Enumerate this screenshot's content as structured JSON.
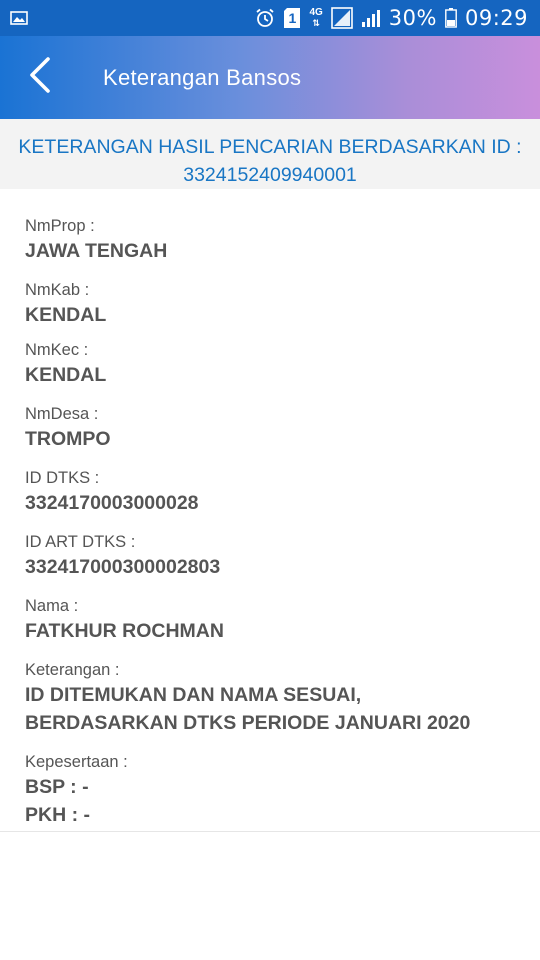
{
  "status_bar": {
    "network": "4G",
    "battery": "30%",
    "time": "09:29",
    "sim_badge": "1",
    "icons": [
      "gallery-icon",
      "alarm-icon",
      "sim-icon",
      "signal-icon",
      "battery-icon"
    ]
  },
  "app_bar": {
    "title": "Keterangan Bansos",
    "back_icon": "chevron-left-icon"
  },
  "header": {
    "line1": "KETERANGAN HASIL PENCARIAN BERDASARKAN ID :",
    "line2": "3324152409940001"
  },
  "fields": [
    {
      "label": "NmProp :",
      "value": "JAWA TENGAH"
    },
    {
      "label": "NmKab :",
      "value": "KENDAL"
    },
    {
      "label": "NmKec :",
      "value": "KENDAL"
    },
    {
      "label": "NmDesa :",
      "value": "TROMPO"
    },
    {
      "label": "ID DTKS :",
      "value": "3324170003000028"
    },
    {
      "label": "ID ART DTKS :",
      "value": "332417000300002803"
    },
    {
      "label": "Nama :",
      "value": "FATKHUR ROCHMAN"
    },
    {
      "label": "Keterangan :",
      "value_lines": [
        "ID DITEMUKAN DAN NAMA SESUAI,",
        "BERDASARKAN DTKS PERIODE JANUARI 2020"
      ]
    },
    {
      "label": "Kepesertaan :",
      "value_lines": [
        "BSP : -",
        "PKH : -"
      ]
    }
  ],
  "colors": {
    "status_bar": "#1565c0",
    "header_text": "#1976c4",
    "text": "#555555"
  }
}
